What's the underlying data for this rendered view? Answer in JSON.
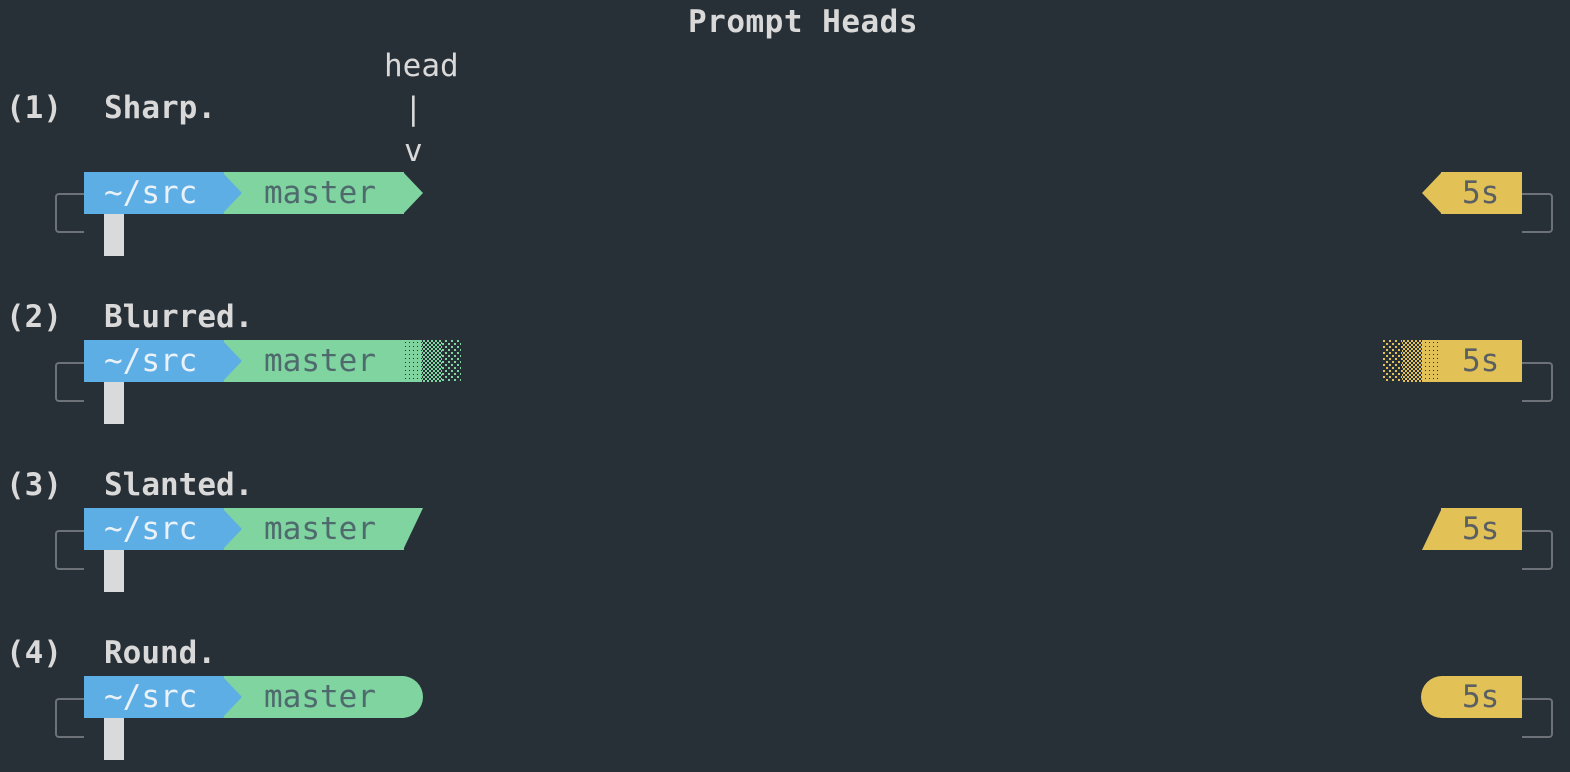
{
  "title": "Prompt Heads",
  "annotation": {
    "word": "head",
    "bar": "|",
    "arrow": "v"
  },
  "prompt": {
    "dir": "~/src",
    "branch": "master",
    "time": "5s"
  },
  "colors": {
    "background": "#283037",
    "dir_segment": "#5eaee6",
    "branch_segment": "#7fd4a0",
    "time_segment": "#e2c256",
    "cursor": "#d9dadb",
    "frame": "#6c7278"
  },
  "styles": [
    {
      "number": "(1)",
      "name": "Sharp.",
      "head": "sharp"
    },
    {
      "number": "(2)",
      "name": "Blurred.",
      "head": "blurred"
    },
    {
      "number": "(3)",
      "name": "Slanted.",
      "head": "slanted"
    },
    {
      "number": "(4)",
      "name": "Round.",
      "head": "round"
    }
  ]
}
